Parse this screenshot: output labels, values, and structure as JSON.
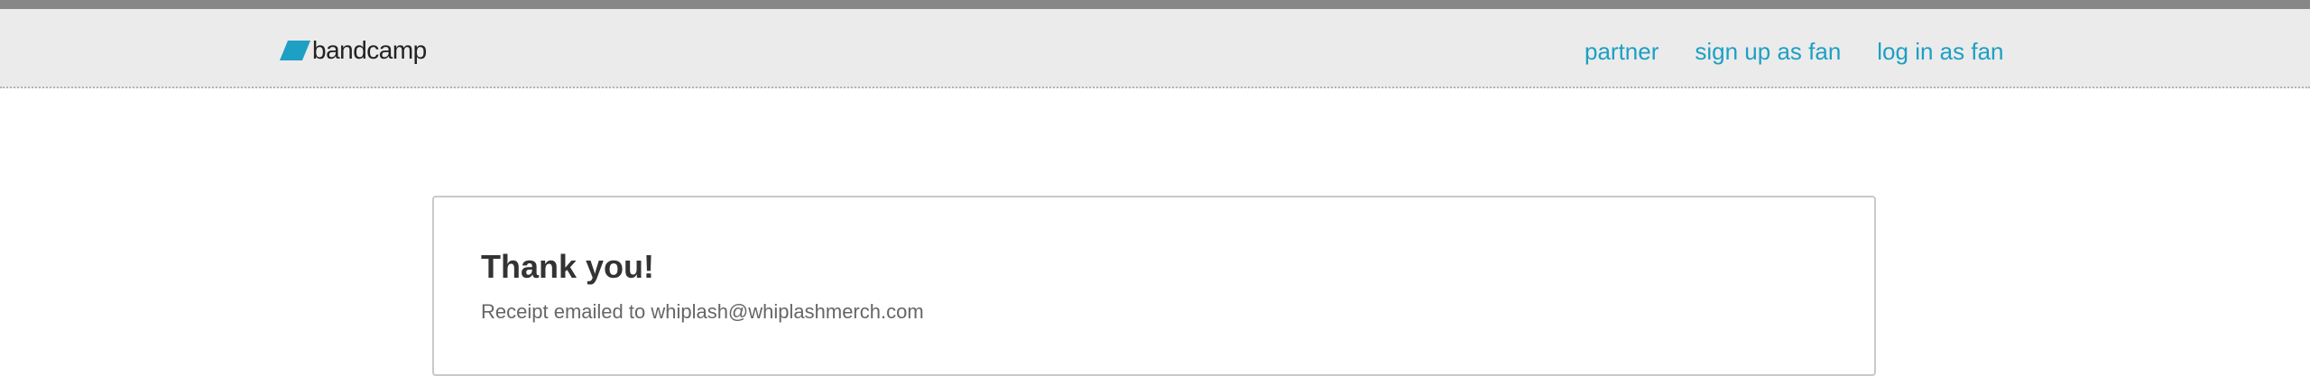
{
  "header": {
    "logo_text": "bandcamp",
    "brand_color": "#1da0c3",
    "nav": [
      {
        "label": "partner"
      },
      {
        "label": "sign up as fan"
      },
      {
        "label": "log in as fan"
      }
    ]
  },
  "main": {
    "title": "Thank you!",
    "receipt_text": "Receipt emailed to whiplash@whiplashmerch.com"
  }
}
